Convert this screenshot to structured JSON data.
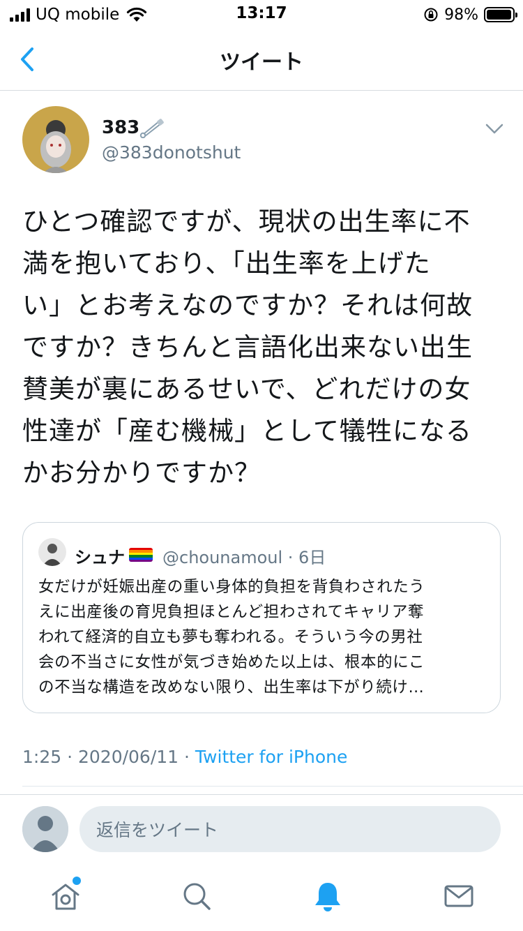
{
  "status_bar": {
    "carrier": "UQ mobile",
    "time": "13:17",
    "battery_percent_text": "98%",
    "battery_level": 0.98
  },
  "navbar": {
    "title": "ツイート"
  },
  "tweet": {
    "display_name": "383",
    "handle": "@383donotshut",
    "text": "ひとつ確認ですが、現状の出生率に不\n満を抱いており、「出生率を上げた\nい」とお考えなのですか？それは何故\nですか？きちんと言語化出来ない出生\n賛美が裏にあるせいで、どれだけの女\n性達が「産む機械」として犠牲になる\nかお分かりですか？",
    "timestamp": "1:25 · 2020/06/11 · ",
    "source": "Twitter for iPhone"
  },
  "quote": {
    "display_name": "シュナ",
    "handle_time": "@chounamoul · 6日",
    "text": "女だけが妊娠出産の重い身体的負担を背負わされたう\nえに出産後の育児負担ほとんど担わされてキャリア奪\nわれて経済的自立も夢も奪われる。そういう今の男社\n会の不当さに女性が気づき始めた以上は、根本的にこ\nの不当な構造を改めない限り、出生率は下がり続け…"
  },
  "reply": {
    "placeholder": "返信をツイート"
  },
  "colors": {
    "accent": "#1da1f2",
    "secondary_text": "#657786",
    "border": "#ccd6dd"
  },
  "tabbar": {
    "icons": [
      "home-icon",
      "search-icon",
      "notifications-icon",
      "messages-icon"
    ],
    "active": "notifications-icon"
  }
}
